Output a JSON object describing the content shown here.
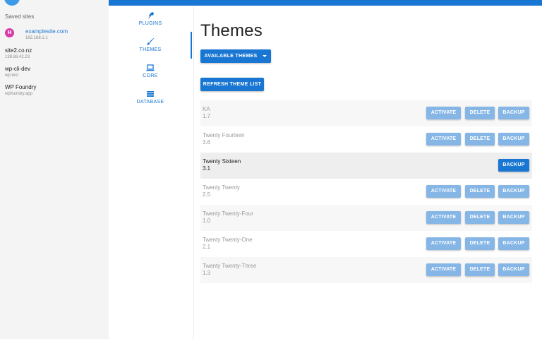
{
  "sidebar": {
    "saved_label": "Saved sites",
    "sites": [
      {
        "badge": "H",
        "name": "examplesite.com",
        "ip": "192.168.1.1"
      },
      {
        "name": "site2.co.nz",
        "ip": "139.88.42.23"
      },
      {
        "name": "wp-cli-dev",
        "ip": "wp.test"
      },
      {
        "name": "WP Foundry",
        "ip": "wpfoundry.app"
      }
    ]
  },
  "nav": {
    "items": [
      {
        "label": "PLUGINS",
        "icon": "plug-icon"
      },
      {
        "label": "THEMES",
        "icon": "brush-icon"
      },
      {
        "label": "CORE",
        "icon": "laptop-icon"
      },
      {
        "label": "DATABASE",
        "icon": "list-icon"
      }
    ]
  },
  "main": {
    "title": "Themes",
    "available_label": "AVAILABLE THEMES",
    "refresh_label": "REFRESH THEME LIST",
    "actions": {
      "activate": "ACTIVATE",
      "delete": "DELETE",
      "backup": "BACKUP"
    },
    "themes": [
      {
        "name": "KA",
        "version": "1.7"
      },
      {
        "name": "Twenty Fourteen",
        "version": "3.6"
      },
      {
        "name": "Twenty Sixteen",
        "version": "3.1"
      },
      {
        "name": "Twenty Twenty",
        "version": "2.5"
      },
      {
        "name": "Twenty Twenty-Four",
        "version": "1.0"
      },
      {
        "name": "Twenty Twenty-One",
        "version": "2.1"
      },
      {
        "name": "Twenty Twenty-Three",
        "version": "1.3"
      }
    ]
  },
  "colors": {
    "primary": "#1976d2",
    "badge": "#d63ba8"
  }
}
